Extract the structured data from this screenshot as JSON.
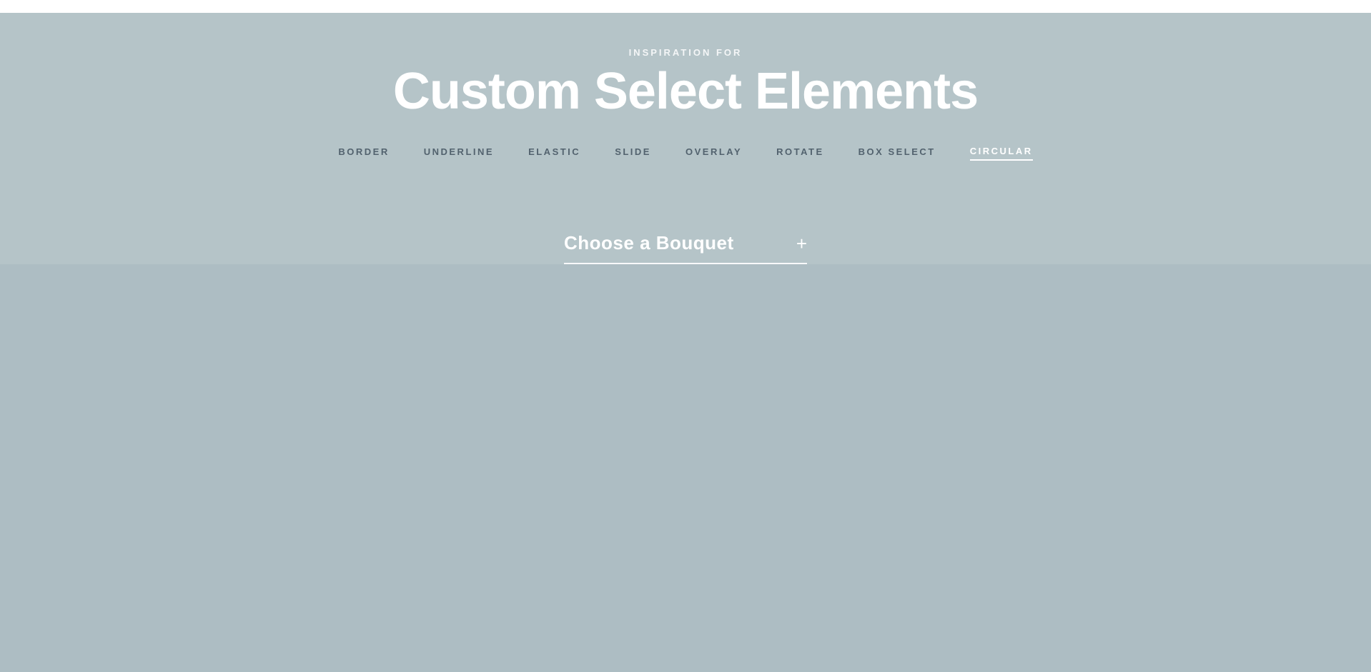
{
  "top_bar": {},
  "header": {
    "inspiration_label": "INSPIRATION FOR",
    "page_title": "Custom Select Elements"
  },
  "nav": {
    "tabs": [
      {
        "id": "border",
        "label": "BORDER",
        "active": false
      },
      {
        "id": "underline",
        "label": "UNDERLINE",
        "active": false
      },
      {
        "id": "elastic",
        "label": "ELASTIC",
        "active": false
      },
      {
        "id": "slide",
        "label": "SLIDE",
        "active": false
      },
      {
        "id": "overlay",
        "label": "OVERLAY",
        "active": false
      },
      {
        "id": "rotate",
        "label": "ROTATE",
        "active": false
      },
      {
        "id": "box-select",
        "label": "BOX SELECT",
        "active": false
      },
      {
        "id": "circular",
        "label": "CIRCULAR",
        "active": true
      }
    ]
  },
  "select_widget": {
    "placeholder": "Choose a Bouquet",
    "icon": "+"
  },
  "colors": {
    "background": "#b5c4c8",
    "text_white": "#ffffff",
    "text_dark": "rgba(50,65,80,0.75)"
  }
}
